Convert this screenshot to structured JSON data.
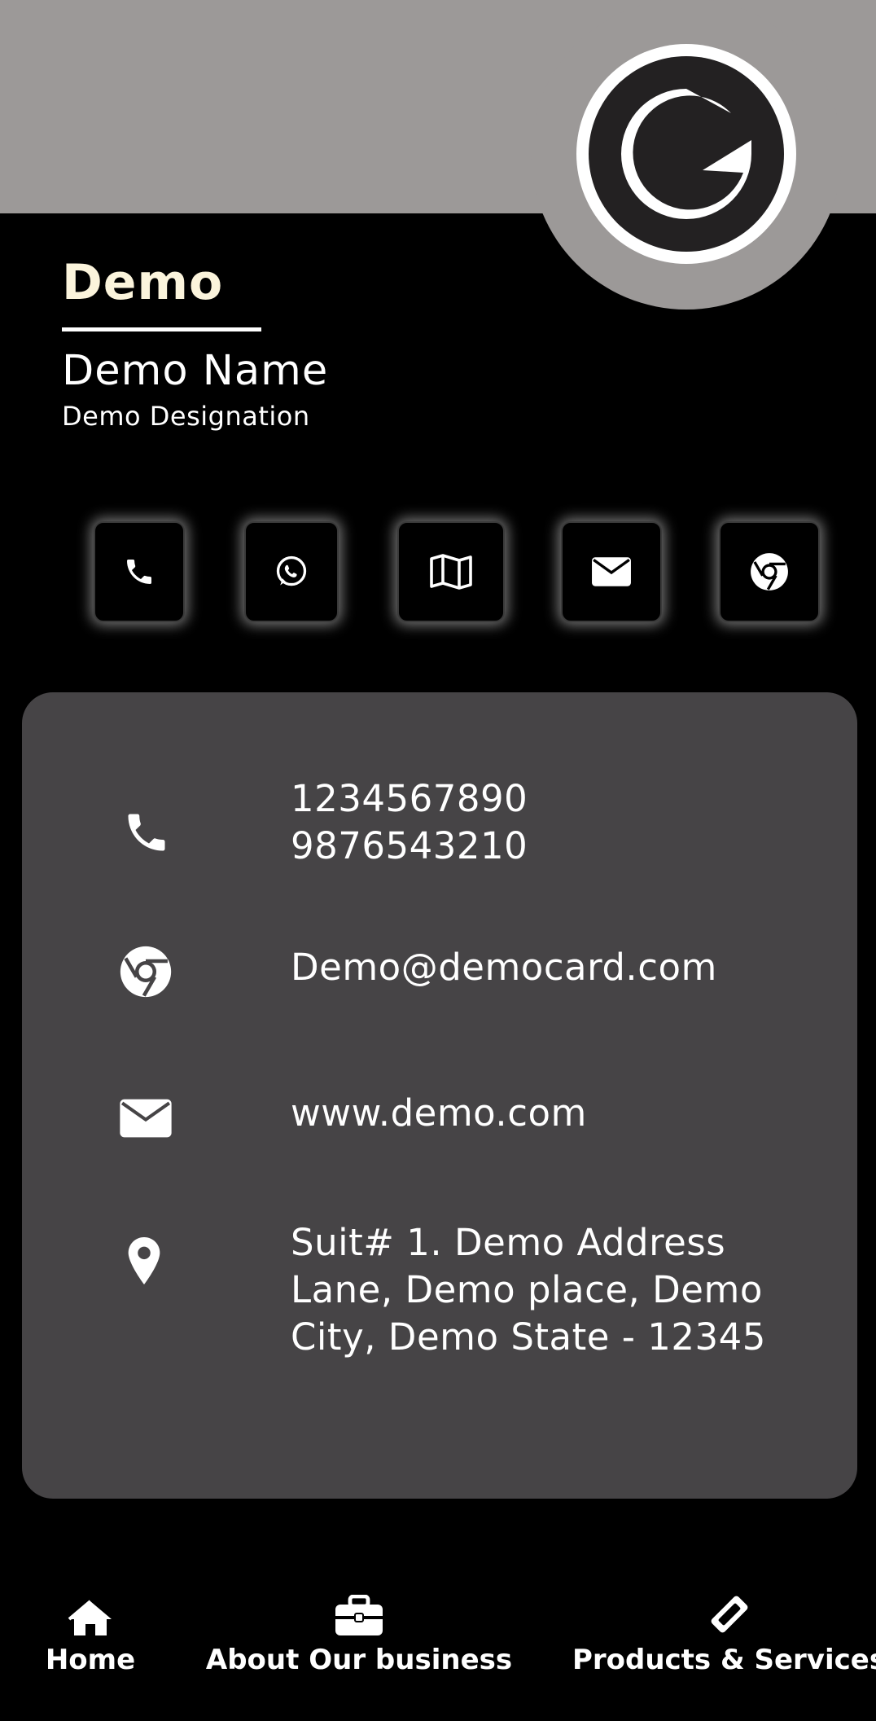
{
  "company": {
    "name": "Demo"
  },
  "profile": {
    "name": "Demo Name",
    "designation": "Demo Designation"
  },
  "actions": [
    {
      "icon": "phone-icon"
    },
    {
      "icon": "whatsapp-icon"
    },
    {
      "icon": "map-icon"
    },
    {
      "icon": "envelope-icon"
    },
    {
      "icon": "chrome-icon"
    }
  ],
  "contact": {
    "phones": [
      "1234567890",
      "9876543210"
    ],
    "email": "Demo@democard.com",
    "website": "www.demo.com",
    "address_lines": [
      "Suit# 1. Demo Address",
      "Lane, Demo place, Demo",
      "City, Demo State - 12345"
    ]
  },
  "nav": {
    "home": "Home",
    "about": "About Our business",
    "products": "Products & Services"
  },
  "colors": {
    "header_gray": "#9c9998",
    "card_gray": "#464446",
    "company_text": "#fbf4dc",
    "background": "#000000"
  }
}
